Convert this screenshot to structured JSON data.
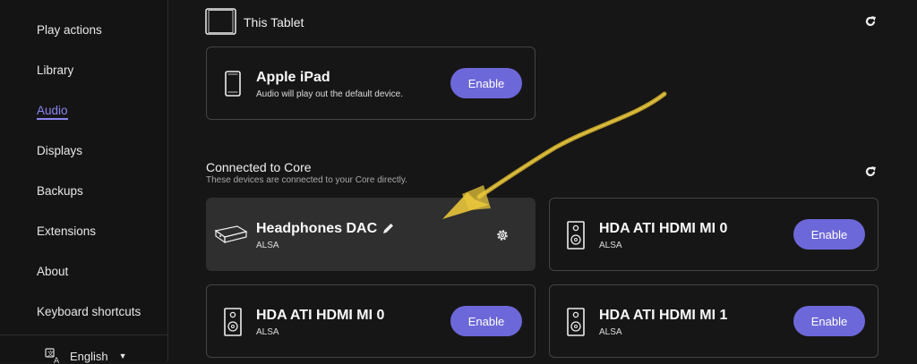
{
  "sidebar": {
    "items": [
      {
        "label": "Play actions"
      },
      {
        "label": "Library"
      },
      {
        "label": "Audio",
        "active": true
      },
      {
        "label": "Displays"
      },
      {
        "label": "Backups"
      },
      {
        "label": "Extensions"
      },
      {
        "label": "About"
      },
      {
        "label": "Keyboard shortcuts"
      }
    ],
    "language": "English"
  },
  "tablet_section": {
    "title": "This Tablet",
    "device": {
      "name": "Apple iPad",
      "subtitle": "Audio will play out the default device.",
      "button": "Enable",
      "icon": "tablet-icon"
    }
  },
  "core_section": {
    "title": "Connected to Core",
    "subtitle": "These devices are connected to your Core directly.",
    "devices": [
      {
        "name": "Headphones DAC",
        "subtitle": "ALSA",
        "icon": "dac-icon",
        "selected": true
      },
      {
        "name": "HDA ATI HDMI MI 0",
        "subtitle": "ALSA",
        "button": "Enable",
        "icon": "speaker-icon"
      },
      {
        "name": "HDA ATI HDMI MI 0",
        "subtitle": "ALSA",
        "button": "Enable",
        "icon": "speaker-icon"
      },
      {
        "name": "HDA ATI HDMI MI 1",
        "subtitle": "ALSA",
        "button": "Enable",
        "icon": "speaker-icon"
      }
    ]
  },
  "colors": {
    "accent": "#6d68d9",
    "active_nav": "#8a86f0",
    "annotation_arrow": "#e8c53a"
  }
}
